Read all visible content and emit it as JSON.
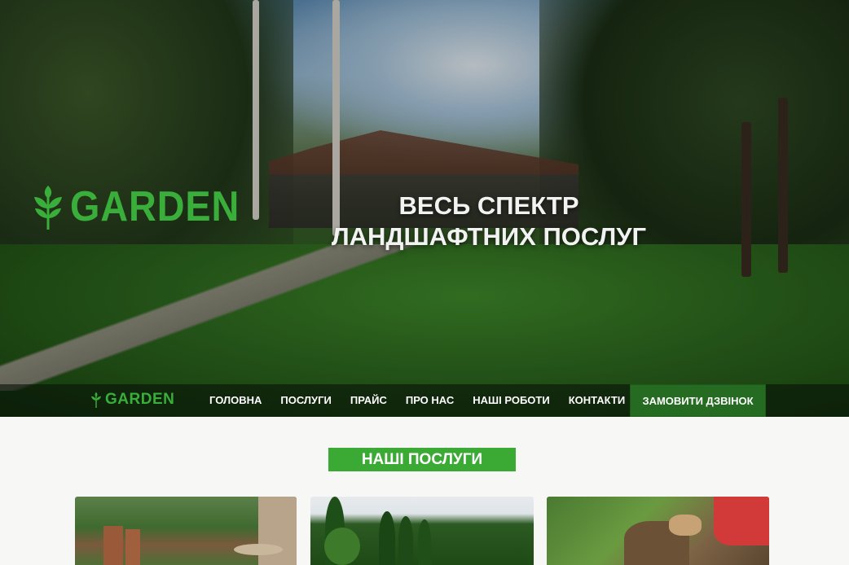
{
  "hero": {
    "logo_text": "GARDEN",
    "title_line1": "ВЕСЬ СПЕКТР",
    "title_line2": "ЛАНДШАФТНИХ ПОСЛУГ"
  },
  "navbar": {
    "logo_text": "GARDEN",
    "items": [
      {
        "label": "ГОЛОВНА"
      },
      {
        "label": "ПОСЛУГИ"
      },
      {
        "label": "ПРАЙС"
      },
      {
        "label": "ПРО НАС"
      },
      {
        "label": "НАШІ РОБОТИ"
      },
      {
        "label": "КОНТАКТИ"
      }
    ],
    "cta_label": "ЗАМОВИТИ ДЗВІНОК"
  },
  "services": {
    "title": "НАШІ ПОСЛУГИ"
  },
  "colors": {
    "brand_green": "#3aae3a",
    "cta_green": "#256b22",
    "section_badge": "#3aaa35"
  }
}
